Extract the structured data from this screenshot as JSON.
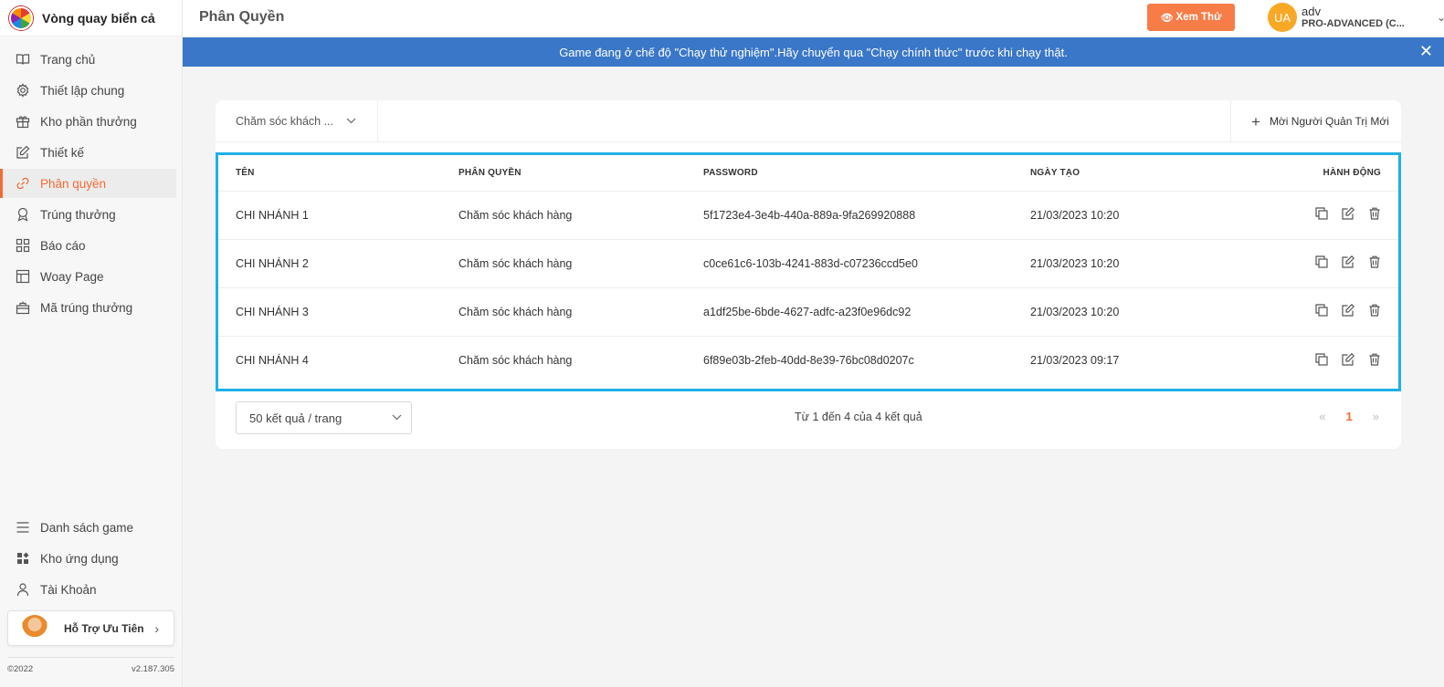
{
  "brand": {
    "name": "Vòng quay biển cả"
  },
  "sidebar": {
    "items": [
      {
        "label": "Trang chủ",
        "icon": "book-icon"
      },
      {
        "label": "Thiết lập chung",
        "icon": "gear-icon"
      },
      {
        "label": "Kho phần thưởng",
        "icon": "gift-icon"
      },
      {
        "label": "Thiết kế",
        "icon": "edit-icon"
      },
      {
        "label": "Phân quyền",
        "icon": "link-icon",
        "active": true
      },
      {
        "label": "Trúng thưởng",
        "icon": "award-icon"
      },
      {
        "label": "Báo cáo",
        "icon": "grid-icon"
      },
      {
        "label": "Woay Page",
        "icon": "layout-icon"
      },
      {
        "label": "Mã trúng thưởng",
        "icon": "ticket-icon"
      }
    ],
    "bottom_items": [
      {
        "label": "Danh sách game",
        "icon": "menu-icon"
      },
      {
        "label": "Kho ứng dụng",
        "icon": "apps-icon"
      },
      {
        "label": "Tài Khoản",
        "icon": "user-icon"
      }
    ],
    "support_label": "Hỗ Trợ Ưu Tiên",
    "copyright": "©2022",
    "version": "v2.187.305"
  },
  "header": {
    "title": "Phân Quyền",
    "preview_label": "Xem Thử",
    "user": {
      "initials": "UA",
      "name": "adv",
      "plan": "PRO-ADVANCED (C..."
    }
  },
  "banner": {
    "text": "Game đang ở chế độ \"Chạy thử nghiệm\".Hãy chuyển qua \"Chạy chính thức\" trước khi chạy thật."
  },
  "filter": {
    "role_select": "Chăm sóc khách ...",
    "invite_label": "Mời Người Quản Trị Mới"
  },
  "table": {
    "headers": [
      "TÊN",
      "PHÂN QUYỀN",
      "PASSWORD",
      "NGÀY TẠO",
      "HÀNH ĐỘNG"
    ],
    "rows": [
      {
        "name": "CHI NHÁNH 1",
        "role": "Chăm sóc khách hàng",
        "password": "5f1723e4-3e4b-440a-889a-9fa269920888",
        "created": "21/03/2023 10:20"
      },
      {
        "name": "CHI NHÁNH 2",
        "role": "Chăm sóc khách hàng",
        "password": "c0ce61c6-103b-4241-883d-c07236ccd5e0",
        "created": "21/03/2023 10:20"
      },
      {
        "name": "CHI NHÁNH 3",
        "role": "Chăm sóc khách hàng",
        "password": "a1df25be-6bde-4627-adfc-a23f0e96dc92",
        "created": "21/03/2023 10:20"
      },
      {
        "name": "CHI NHÁNH 4",
        "role": "Chăm sóc khách hàng",
        "password": "6f89e03b-2feb-40dd-8e39-76bc08d0207c",
        "created": "21/03/2023 09:17"
      }
    ]
  },
  "pagination": {
    "page_size": "50 kết quả / trang",
    "summary": "Từ 1 đến 4 của 4 kết quả",
    "current_page": "1",
    "prev": "«",
    "next": "»"
  },
  "colors": {
    "accent": "#f26b35",
    "banner": "#3a77c8",
    "highlight": "#1fb0e8",
    "preview_button": "#f77c47"
  }
}
